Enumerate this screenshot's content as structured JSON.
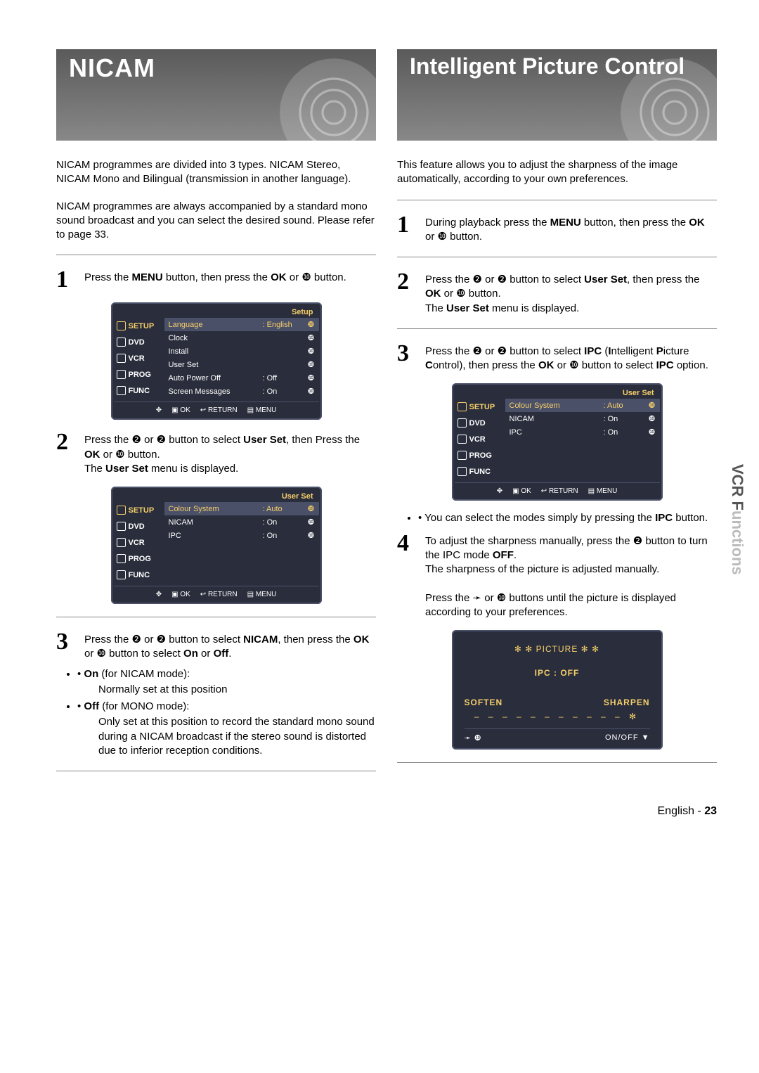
{
  "page": {
    "lang": "English",
    "number": "23",
    "side_tab_bold": "VCR F",
    "side_tab_faded": "unctions"
  },
  "left": {
    "title": "NICAM",
    "intro1": "NICAM programmes are divided into 3 types. NICAM Stereo, NICAM Mono and Bilingual (transmission in another language).",
    "intro2": "NICAM programmes are always accompanied by a standard mono sound broadcast and you can select the desired sound. Please refer to page 33.",
    "step1": {
      "pre": "Press the ",
      "b1": "MENU",
      "mid": " button, then press the ",
      "b2": "OK",
      "post": " or ❿ button."
    },
    "step2": {
      "pre": "Press the ❷ or ❷ button to select ",
      "b1": "User Set",
      "mid": ", then Press the ",
      "b2": "OK",
      "post": " or ❿ button.",
      "line2a": "The ",
      "line2b": "User Set",
      "line2c": " menu is displayed."
    },
    "step3": {
      "pre": "Press the ❷ or ❷ button to select ",
      "b1": "NICAM",
      "mid": ", then press the ",
      "b2": "OK",
      "post": " or ❿ button to select ",
      "b3": "On",
      "post2": " or ",
      "b4": "Off",
      "post3": "."
    },
    "bullets": {
      "on_b": "On",
      "on_tail": " (for NICAM mode):",
      "on_sub": "Normally set at this position",
      "off_b": "Off",
      "off_tail": " (for MONO mode):",
      "off_sub": "Only set at this position to record the standard mono sound during a NICAM broadcast if the stereo sound is distorted due to inferior reception conditions."
    }
  },
  "right": {
    "title": "Intelligent Picture Control",
    "intro": "This feature allows you to adjust the sharpness of the image automatically, according to your own preferences.",
    "step1": {
      "pre": "During playback press the ",
      "b1": "MENU",
      "mid": " button, then press the ",
      "b2": "OK",
      "post": " or ❿ button."
    },
    "step2": {
      "pre": "Press the ❷ or ❷ button to select ",
      "b1": "User Set",
      "mid": ", then press the ",
      "b2": "OK",
      "post": " or ❿ button.",
      "line2a": "The ",
      "line2b": "User Set",
      "line2c": " menu is displayed."
    },
    "step3": {
      "pre": "Press the ❷ or ❷ button to select ",
      "b1": "IPC",
      "mid": " (",
      "b1b": "I",
      "mid2": "ntelligent ",
      "b1c": "P",
      "mid3": "icture ",
      "b1d": "C",
      "mid4": "ontrol), then press the ",
      "b2": "OK",
      "post": " or ❿ button to select ",
      "b3": "IPC",
      "post2": " option."
    },
    "note1": {
      "pre": "You can select the modes simply by pressing the ",
      "b": "IPC",
      "post": " button."
    },
    "step4": {
      "l1_pre": "To adjust the sharpness manually, press the ❷ button to turn the IPC mode ",
      "l1_b": "OFF",
      "l1_post": ".",
      "l2": "The sharpness of the picture is adjusted manually.",
      "l3": "Press the ➛ or ❿ buttons until the picture is displayed according to your preferences."
    }
  },
  "osd_setup": {
    "header": "Setup",
    "side": [
      "SETUP",
      "DVD",
      "VCR",
      "PROG",
      "FUNC"
    ],
    "rows": [
      {
        "label": "Language",
        "value": ": English",
        "arrow": "❿",
        "sel": true
      },
      {
        "label": "Clock",
        "value": "",
        "arrow": "❿"
      },
      {
        "label": "Install",
        "value": "",
        "arrow": "❿"
      },
      {
        "label": "User Set",
        "value": "",
        "arrow": "❿"
      },
      {
        "label": "Auto Power Off",
        "value": ": Off",
        "arrow": "❿"
      },
      {
        "label": "Screen Messages",
        "value": ": On",
        "arrow": "❿"
      }
    ],
    "footer": {
      "ok": "OK",
      "ret": "RETURN",
      "menu": "MENU"
    }
  },
  "osd_user": {
    "header": "User Set",
    "side": [
      "SETUP",
      "DVD",
      "VCR",
      "PROG",
      "FUNC"
    ],
    "rows": [
      {
        "label": "Colour System",
        "value": ": Auto",
        "arrow": "❿",
        "sel": true
      },
      {
        "label": "NICAM",
        "value": ": On",
        "arrow": "❿"
      },
      {
        "label": "IPC",
        "value": ": On",
        "arrow": "❿"
      }
    ],
    "footer": {
      "ok": "OK",
      "ret": "RETURN",
      "menu": "MENU"
    }
  },
  "osd_picture": {
    "title": "✻ ✻   PICTURE   ✻ ✻",
    "ipc": "IPC : OFF",
    "soft": "SOFTEN",
    "sharp": "SHARPEN",
    "scale": "– – – – – – – – – – – ✻",
    "nav_l": "➛ ❿",
    "nav_r": "ON/OFF ▼"
  }
}
